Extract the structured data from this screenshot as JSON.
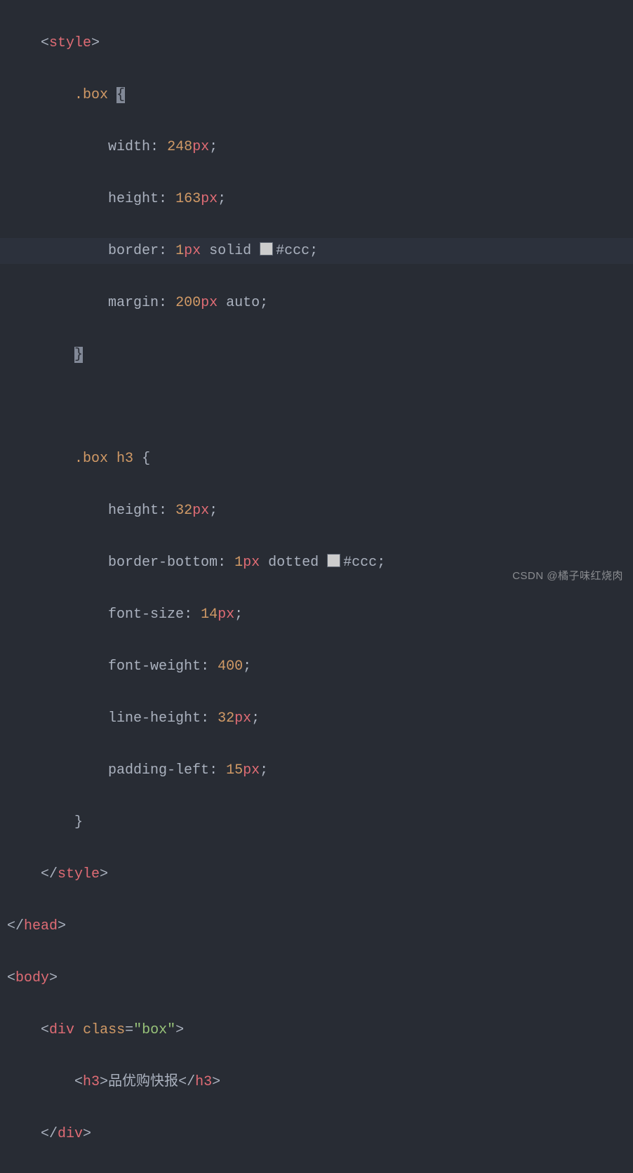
{
  "c": {
    "style_open": "style",
    "style_close": "style",
    "head_close": "head",
    "body_open": "body",
    "div_open": "div",
    "div_close": "div",
    "h3": "h3",
    "class_attr": "class",
    "class_val": "\"box\"",
    "h3_text": "品优购快报",
    "sel_box": ".box",
    "sel_box_h3_a": ".box",
    "sel_box_h3_b": "h3",
    "p_width": "width",
    "v_width_n": "248",
    "v_width_u": "px",
    "p_height": "height",
    "v_height_n": "163",
    "v_height_u": "px",
    "p_border": "border",
    "v_border_n": "1",
    "v_border_u": "px",
    "v_border_style": "solid",
    "v_border_hex": "#ccc",
    "p_margin": "margin",
    "v_margin_n": "200",
    "v_margin_u": "px",
    "v_margin_auto": "auto",
    "p_h3_height": "height",
    "v_h3_height_n": "32",
    "v_h3_height_u": "px",
    "p_bb": "border-bottom",
    "v_bb_n": "1",
    "v_bb_u": "px",
    "v_bb_style": "dotted",
    "v_bb_hex": "#ccc",
    "p_fs": "font-size",
    "v_fs_n": "14",
    "v_fs_u": "px",
    "p_fw": "font-weight",
    "v_fw_n": "400",
    "p_lh": "line-height",
    "v_lh_n": "32",
    "v_lh_u": "px",
    "p_pl": "padding-left",
    "v_pl_n": "15",
    "v_pl_u": "px"
  },
  "watermark": "CSDN @橘子味红烧肉"
}
